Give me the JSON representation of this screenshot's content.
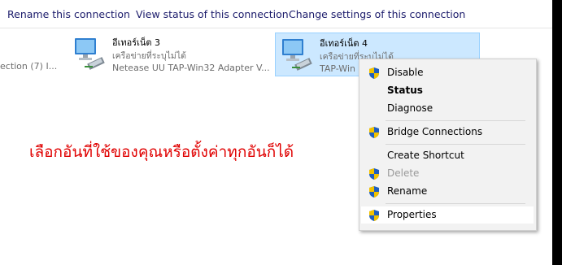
{
  "toolbar": {
    "rename": "Rename this connection",
    "view_status": "View status of this connection",
    "change_settings": "Change settings of this connection"
  },
  "connections": [
    {
      "partial_label": "ection (7) I..."
    },
    {
      "name": "อีเทอร์เน็ต 3",
      "status": "เครือข่ายที่ระบุไม่ได้",
      "adapter": "Netease UU TAP-Win32 Adapter V..."
    },
    {
      "name": "อีเทอร์เน็ต 4",
      "status": "เครือข่ายที่ระบุไม่ได้",
      "adapter": "TAP-Win"
    }
  ],
  "annotation": "เลือกอันที่ใช้ของคุณหรือตั้งค่าทุกอันก็ได้",
  "context_menu": {
    "items": [
      {
        "label": "Disable",
        "shield": true,
        "bold": false,
        "disabled": false
      },
      {
        "label": "Status",
        "shield": false,
        "bold": true,
        "disabled": false
      },
      {
        "label": "Diagnose",
        "shield": false,
        "bold": false,
        "disabled": false
      },
      {
        "label": "Bridge Connections",
        "shield": true,
        "bold": false,
        "disabled": false
      },
      {
        "label": "Create Shortcut",
        "shield": false,
        "bold": false,
        "disabled": false
      },
      {
        "label": "Delete",
        "shield": true,
        "bold": false,
        "disabled": true
      },
      {
        "label": "Rename",
        "shield": true,
        "bold": false,
        "disabled": false
      },
      {
        "label": "Properties",
        "shield": true,
        "bold": false,
        "disabled": false,
        "highlighted": true
      }
    ]
  },
  "colors": {
    "selection_bg": "#cce8ff",
    "annotation": "#e00000",
    "shield_blue": "#1f5fbf",
    "shield_yellow": "#f2c200"
  }
}
